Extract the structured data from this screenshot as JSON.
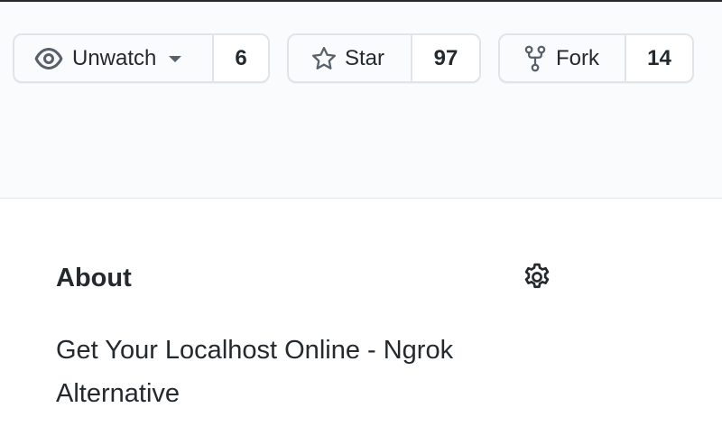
{
  "repo_actions": {
    "watch": {
      "label": "Unwatch",
      "count": "6"
    },
    "star": {
      "label": "Star",
      "count": "97"
    },
    "fork": {
      "label": "Fork",
      "count": "14"
    }
  },
  "about": {
    "title": "About",
    "description": "Get Your Localhost Online - Ngrok Alternative"
  },
  "icons": {
    "watch": "eye-icon",
    "watch_menu": "caret-down-icon",
    "star": "star-icon",
    "fork": "fork-icon",
    "settings": "gear-icon"
  },
  "colors": {
    "text": "#24292e",
    "icon": "#586069",
    "border": "#e1e4e8",
    "band_bg": "#fafbfc"
  }
}
